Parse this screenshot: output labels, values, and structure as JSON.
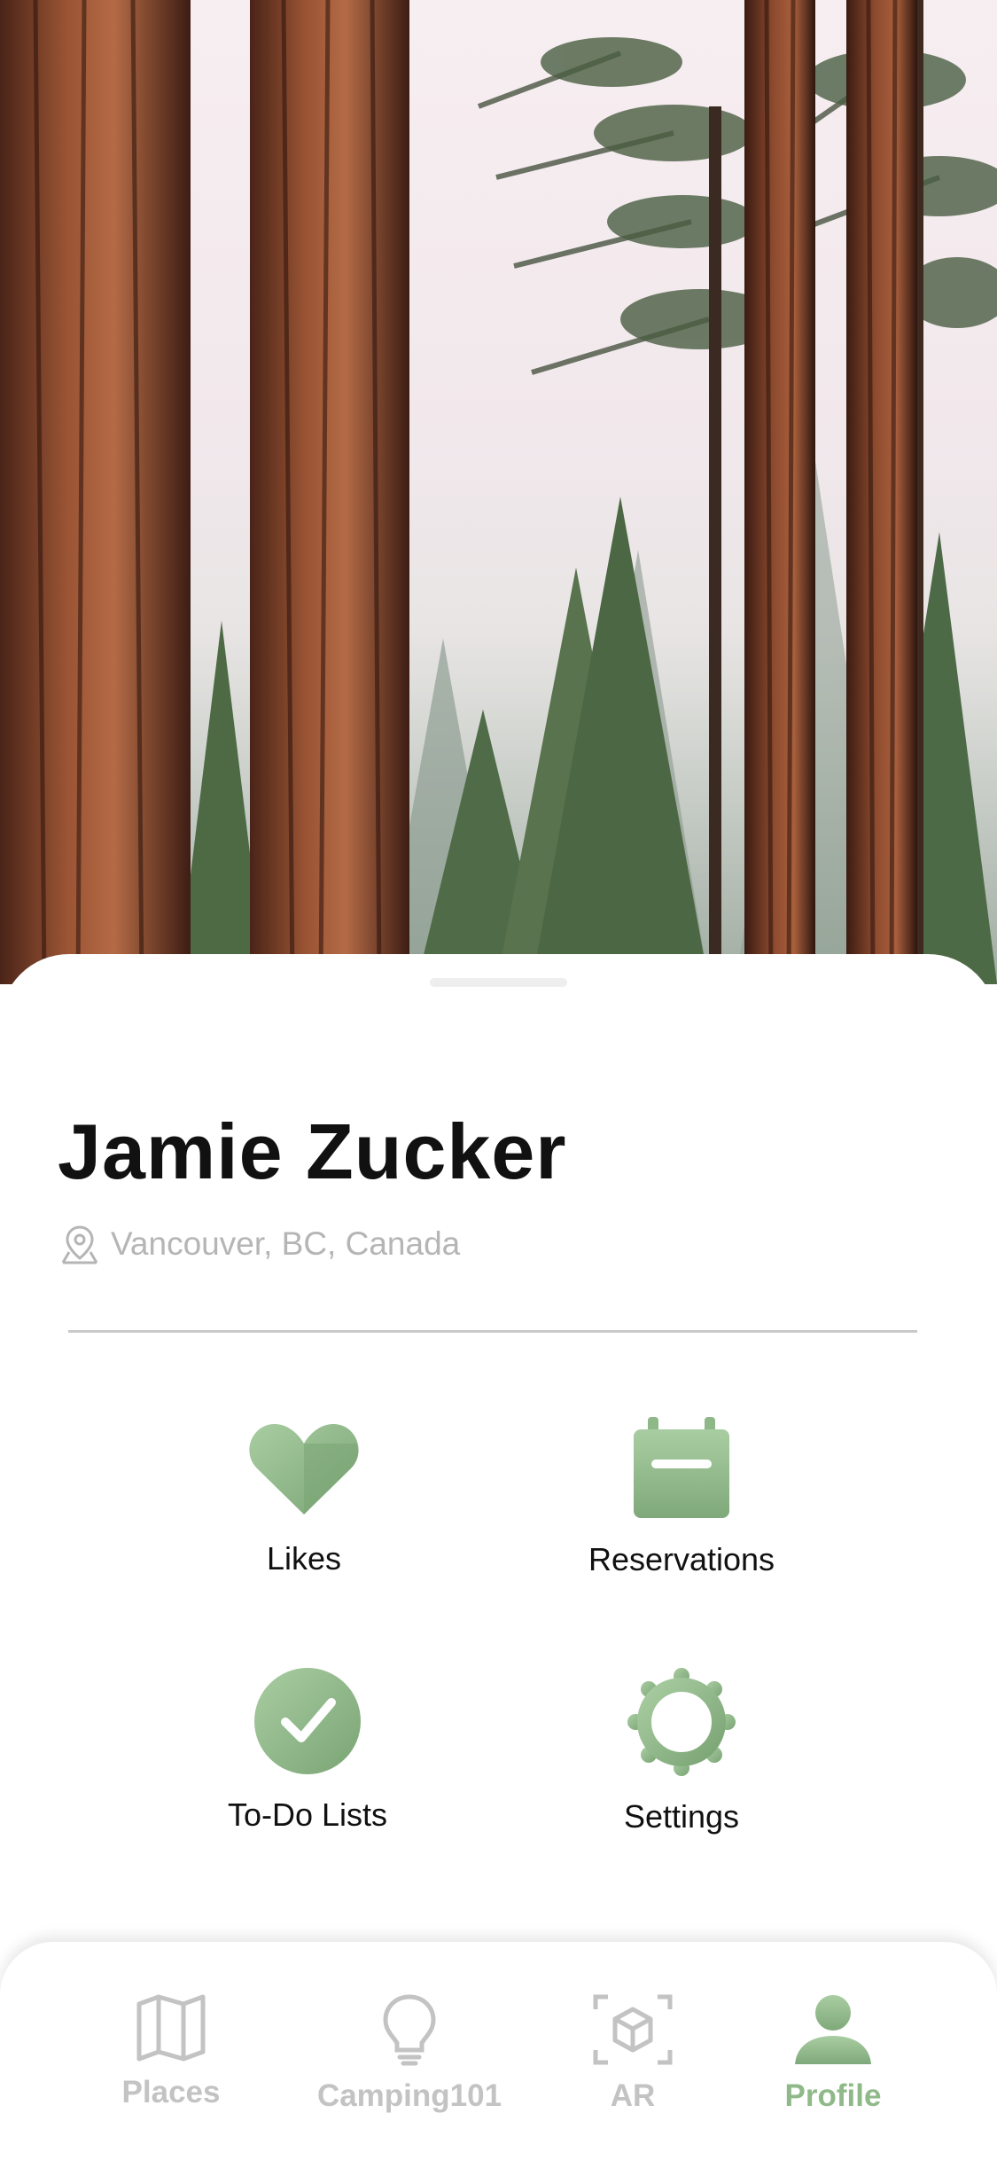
{
  "profile": {
    "name": "Jamie Zucker",
    "location": "Vancouver, BC, Canada"
  },
  "menu": {
    "likes_label": "Likes",
    "reservations_label": "Reservations",
    "todo_label": "To-Do Lists",
    "settings_label": "Settings"
  },
  "tabs": [
    {
      "label": "Places",
      "icon": "map-icon",
      "active": false
    },
    {
      "label": "Camping101",
      "icon": "lightbulb-icon",
      "active": false
    },
    {
      "label": "AR",
      "icon": "ar-cube-icon",
      "active": false
    },
    {
      "label": "Profile",
      "icon": "person-icon",
      "active": true
    }
  ],
  "colors": {
    "accent": "#90b98a",
    "accent_dark": "#7fa97a",
    "inactive": "#c3c3c3"
  }
}
